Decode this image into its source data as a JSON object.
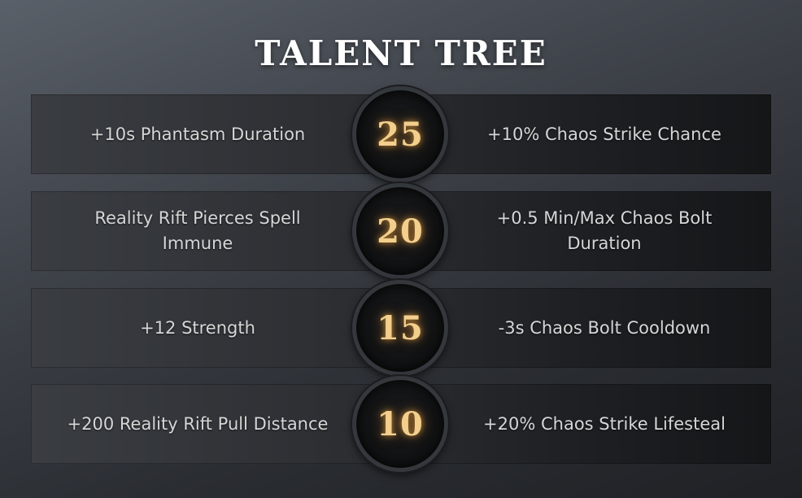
{
  "title": "TALENT TREE",
  "colors": {
    "level_text": "#f3cf8e",
    "talent_text": "#d6d6d6",
    "title_text": "#ffffff"
  },
  "rows": [
    {
      "level": "25",
      "left": "+10s Phantasm Duration",
      "right": "+10% Chaos Strike Chance"
    },
    {
      "level": "20",
      "left": "Reality Rift Pierces Spell Immune",
      "right": "+0.5 Min/Max Chaos Bolt Duration"
    },
    {
      "level": "15",
      "left": "+12 Strength",
      "right": "-3s Chaos Bolt Cooldown"
    },
    {
      "level": "10",
      "left": "+200 Reality Rift Pull Distance",
      "right": "+20% Chaos Strike Lifesteal"
    }
  ]
}
